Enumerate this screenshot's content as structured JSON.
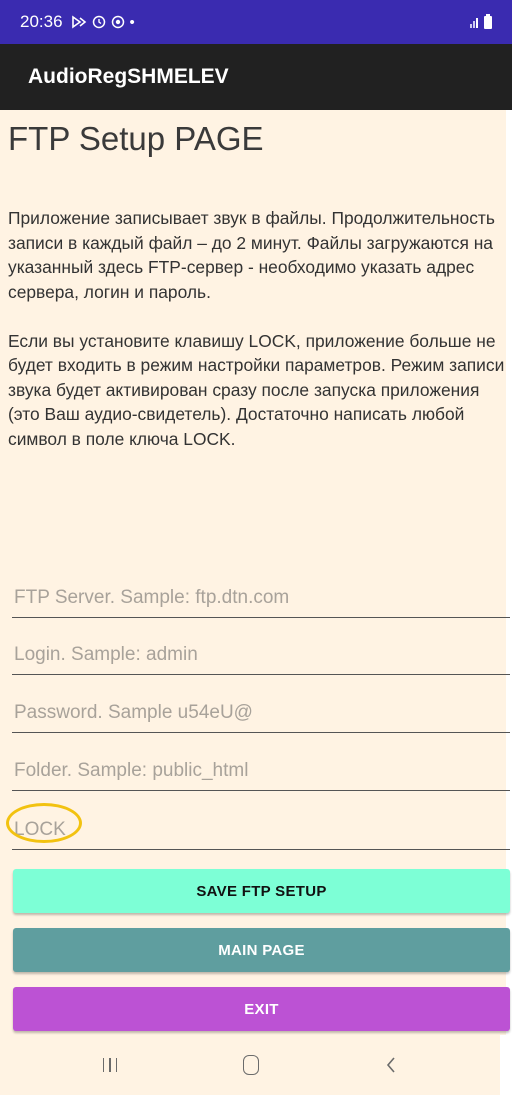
{
  "status_bar": {
    "time": "20:36",
    "notification_icons": [
      "play-outline-icon",
      "sync-icon",
      "record-icon",
      "dot-icon"
    ],
    "dot": "•"
  },
  "app_bar": {
    "title": "AudioRegSHMELEV"
  },
  "page": {
    "title": "FTP Setup PAGE",
    "description": "Приложение записывает звук в файлы. Продолжительность записи в каждый файл – до 2 минут. Файлы загружаются на указанный здесь FTP-сервер - необходимо указать адрес сервера, логин и пароль.\n\nЕсли вы установите клавишу LOCK, приложение больше не будет входить в режим настройки параметров. Режим записи звука будет активирован сразу после запуска приложения (это Ваш аудио-свидетель). Достаточно написать любой символ в поле ключа LOCK."
  },
  "form": {
    "ftp_server": {
      "value": "",
      "placeholder": "FTP Server. Sample: ftp.dtn.com"
    },
    "login": {
      "value": "",
      "placeholder": "Login. Sample: admin"
    },
    "password": {
      "value": "",
      "placeholder": "Password. Sample u54eU@"
    },
    "folder": {
      "value": "",
      "placeholder": "Folder. Sample: public_html"
    },
    "lock": {
      "value": "",
      "placeholder": "LOCK"
    }
  },
  "buttons": {
    "save": "SAVE FTP SETUP",
    "main": "MAIN PAGE",
    "exit": "EXIT"
  },
  "colors": {
    "status_bar": "#3a2bb0",
    "app_bar": "#212121",
    "background": "#fff3e3",
    "save_button": "#7dffd6",
    "main_button": "#5f9e9f",
    "exit_button": "#bc52d4",
    "annotation_circle": "#f2c210"
  },
  "navigation_bar": {
    "icons": [
      "recent-apps-icon",
      "home-icon",
      "back-icon"
    ]
  }
}
